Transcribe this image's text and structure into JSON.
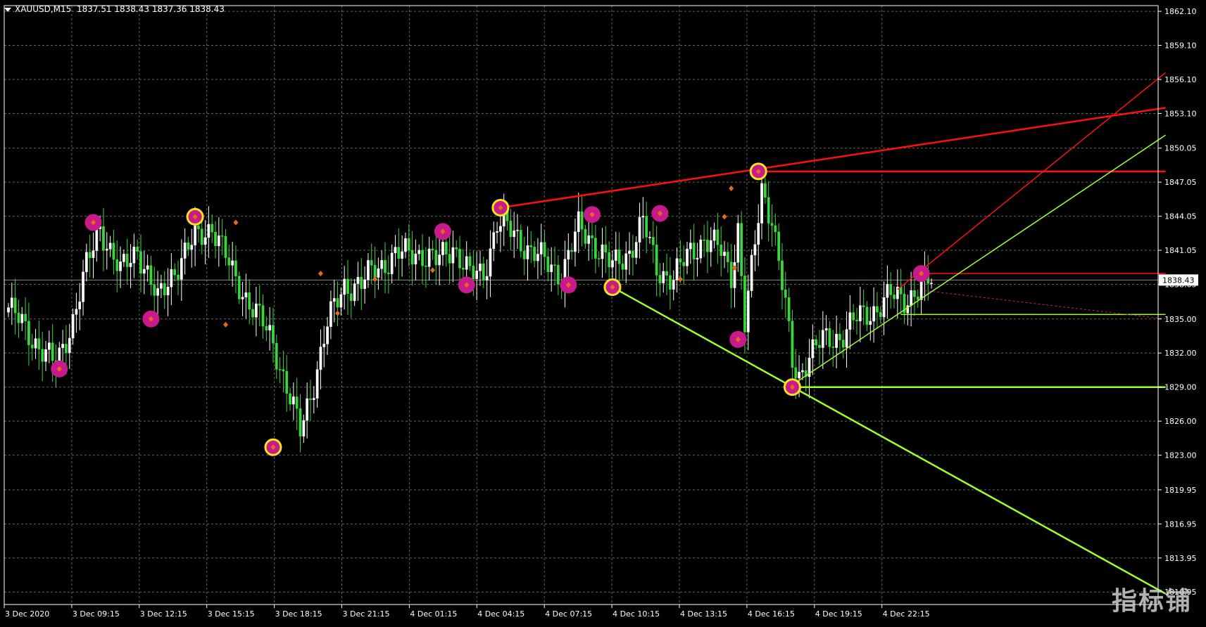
{
  "window": {
    "symbol_label": "XAUUSD,M15",
    "ohlc_label": "1837.51 1838.43 1837.36 1838.43"
  },
  "watermark": "指标铺",
  "colors": {
    "background": "#000000",
    "grid": "#5a6a5a",
    "bull": "#ffffff",
    "bear": "#39d839",
    "resistance": "#ff1010",
    "support": "#9cff2e",
    "marker_magenta": "#c81a8c",
    "marker_yellow": "#ffe21a",
    "fractal": "#e46a1a",
    "price_line": "#8c8c8c"
  },
  "chart_data": {
    "type": "candlestick",
    "symbol": "XAUUSD",
    "timeframe": "M15",
    "current_price": "1838.43",
    "ylim": [
      1809.85,
      1862.6
    ],
    "price_ticks": [
      "1862.10",
      "1859.10",
      "1856.10",
      "1853.10",
      "1850.05",
      "1847.05",
      "1844.05",
      "1841.05",
      "1838.05",
      "1835.00",
      "1832.00",
      "1829.00",
      "1826.00",
      "1823.00",
      "1819.95",
      "1816.95",
      "1813.95",
      "1810.95"
    ],
    "time_ticks": [
      "3 Dec 2020",
      "3 Dec 09:15",
      "3 Dec 12:15",
      "3 Dec 15:15",
      "3 Dec 18:15",
      "3 Dec 21:15",
      "4 Dec 01:15",
      "4 Dec 04:15",
      "4 Dec 07:15",
      "4 Dec 10:15",
      "4 Dec 13:15",
      "4 Dec 16:15",
      "4 Dec 19:15",
      "4 Dec 22:15"
    ],
    "price_anchors": [
      {
        "bar": 0,
        "price": 1836.0
      },
      {
        "bar": 8,
        "price": 1833.0
      },
      {
        "bar": 14,
        "price": 1830.8
      },
      {
        "bar": 19,
        "price": 1835.0
      },
      {
        "bar": 23,
        "price": 1839.5
      },
      {
        "bar": 27,
        "price": 1843.2
      },
      {
        "bar": 33,
        "price": 1839.0
      },
      {
        "bar": 38,
        "price": 1841.3
      },
      {
        "bar": 44,
        "price": 1836.5
      },
      {
        "bar": 48,
        "price": 1839.0
      },
      {
        "bar": 55,
        "price": 1842.0
      },
      {
        "bar": 60,
        "price": 1843.3
      },
      {
        "bar": 66,
        "price": 1839.0
      },
      {
        "bar": 70,
        "price": 1837.0
      },
      {
        "bar": 74,
        "price": 1835.0
      },
      {
        "bar": 78,
        "price": 1833.0
      },
      {
        "bar": 83,
        "price": 1828.0
      },
      {
        "bar": 86,
        "price": 1825.0
      },
      {
        "bar": 90,
        "price": 1829.5
      },
      {
        "bar": 94,
        "price": 1834.5
      },
      {
        "bar": 99,
        "price": 1838.0
      },
      {
        "bar": 104,
        "price": 1838.0
      },
      {
        "bar": 108,
        "price": 1839.5
      },
      {
        "bar": 114,
        "price": 1840.5
      },
      {
        "bar": 120,
        "price": 1841.0
      },
      {
        "bar": 126,
        "price": 1840.0
      },
      {
        "bar": 131,
        "price": 1841.5
      },
      {
        "bar": 136,
        "price": 1838.8
      },
      {
        "bar": 140,
        "price": 1839.0
      },
      {
        "bar": 144,
        "price": 1843.5
      },
      {
        "bar": 149,
        "price": 1842.5
      },
      {
        "bar": 154,
        "price": 1841.0
      },
      {
        "bar": 158,
        "price": 1840.0
      },
      {
        "bar": 163,
        "price": 1839.0
      },
      {
        "bar": 168,
        "price": 1843.0
      },
      {
        "bar": 172,
        "price": 1842.0
      },
      {
        "bar": 178,
        "price": 1839.5
      },
      {
        "bar": 183,
        "price": 1841.0
      },
      {
        "bar": 187,
        "price": 1843.5
      },
      {
        "bar": 191,
        "price": 1839.5
      },
      {
        "bar": 196,
        "price": 1838.5
      },
      {
        "bar": 201,
        "price": 1841.0
      },
      {
        "bar": 205,
        "price": 1842.0
      },
      {
        "bar": 210,
        "price": 1841.0
      },
      {
        "bar": 213,
        "price": 1839.0
      },
      {
        "bar": 215,
        "price": 1843.0
      },
      {
        "bar": 217,
        "price": 1834.5
      },
      {
        "bar": 220,
        "price": 1841.5
      },
      {
        "bar": 222,
        "price": 1846.5
      },
      {
        "bar": 225,
        "price": 1844.0
      },
      {
        "bar": 227,
        "price": 1840.0
      },
      {
        "bar": 229,
        "price": 1836.0
      },
      {
        "bar": 231,
        "price": 1831.0
      },
      {
        "bar": 233,
        "price": 1830.0
      },
      {
        "bar": 236,
        "price": 1832.0
      },
      {
        "bar": 240,
        "price": 1833.0
      },
      {
        "bar": 245,
        "price": 1833.5
      },
      {
        "bar": 250,
        "price": 1835.0
      },
      {
        "bar": 256,
        "price": 1836.0
      },
      {
        "bar": 260,
        "price": 1837.0
      },
      {
        "bar": 264,
        "price": 1836.8
      },
      {
        "bar": 268,
        "price": 1837.5
      },
      {
        "bar": 272,
        "price": 1838.4
      }
    ],
    "trend_lines": [
      {
        "color": "resistance",
        "width": 2.5,
        "points": [
          [
            145,
            1844.8
          ],
          [
            341,
            1853.6
          ]
        ]
      },
      {
        "color": "resistance",
        "width": 2.5,
        "points": [
          [
            221,
            1848.0
          ],
          [
            341,
            1848.0
          ]
        ]
      },
      {
        "color": "resistance",
        "width": 1.5,
        "points": [
          [
            262,
            1837.6
          ],
          [
            341,
            1856.7
          ]
        ]
      },
      {
        "color": "resistance",
        "width": 1.5,
        "points": [
          [
            268,
            1839.0
          ],
          [
            341,
            1839.0
          ]
        ]
      },
      {
        "color": "support",
        "width": 2.5,
        "points": [
          [
            178,
            1837.8
          ],
          [
            341,
            1810.8
          ]
        ]
      },
      {
        "color": "support",
        "width": 2.5,
        "points": [
          [
            230,
            1829.0
          ],
          [
            341,
            1829.0
          ]
        ]
      },
      {
        "color": "support",
        "width": 1.5,
        "points": [
          [
            230,
            1829.0
          ],
          [
            341,
            1851.2
          ]
        ]
      },
      {
        "color": "support",
        "width": 1.5,
        "points": [
          [
            263,
            1835.4
          ],
          [
            341,
            1835.4
          ]
        ]
      }
    ],
    "projection_line": {
      "color": "marker_magenta",
      "points": [
        [
          270,
          1837.5
        ],
        [
          341,
          1835.0
        ]
      ]
    },
    "swing_markers": [
      {
        "bar": 15,
        "price": 1830.6,
        "style": "magenta"
      },
      {
        "bar": 25,
        "price": 1843.5,
        "style": "magenta"
      },
      {
        "bar": 42,
        "price": 1835.0,
        "style": "magenta"
      },
      {
        "bar": 55,
        "price": 1844.0,
        "style": "yellow"
      },
      {
        "bar": 78,
        "price": 1823.7,
        "style": "yellow"
      },
      {
        "bar": 128,
        "price": 1842.7,
        "style": "magenta"
      },
      {
        "bar": 135,
        "price": 1838.0,
        "style": "magenta"
      },
      {
        "bar": 145,
        "price": 1844.8,
        "style": "yellow"
      },
      {
        "bar": 165,
        "price": 1838.0,
        "style": "magenta"
      },
      {
        "bar": 172,
        "price": 1844.2,
        "style": "magenta"
      },
      {
        "bar": 178,
        "price": 1837.8,
        "style": "yellow"
      },
      {
        "bar": 192,
        "price": 1844.3,
        "style": "magenta"
      },
      {
        "bar": 215,
        "price": 1833.2,
        "style": "magenta"
      },
      {
        "bar": 221,
        "price": 1848.0,
        "style": "yellow"
      },
      {
        "bar": 231,
        "price": 1829.0,
        "style": "yellow"
      },
      {
        "bar": 269,
        "price": 1839.0,
        "style": "magenta"
      }
    ],
    "fractals": [
      {
        "bar": 67,
        "price": 1843.5
      },
      {
        "bar": 64,
        "price": 1834.5
      },
      {
        "bar": 92,
        "price": 1839.0
      },
      {
        "bar": 97,
        "price": 1835.5
      },
      {
        "bar": 108,
        "price": 1838.5
      },
      {
        "bar": 125,
        "price": 1839.3
      },
      {
        "bar": 213,
        "price": 1846.5
      },
      {
        "bar": 214,
        "price": 1839.5
      },
      {
        "bar": 211,
        "price": 1844.0
      },
      {
        "bar": 198,
        "price": 1838.5
      }
    ],
    "total_bars": 273
  }
}
